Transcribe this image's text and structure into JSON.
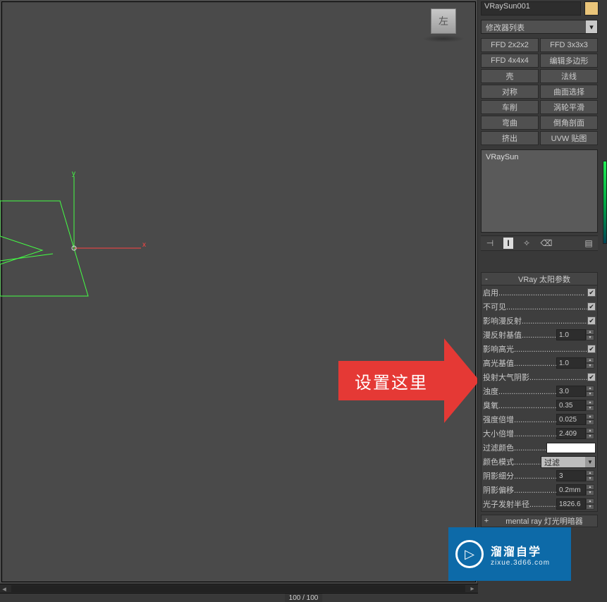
{
  "viewport": {
    "viewcube_label": "左",
    "axis_x": "x",
    "axis_y": "y"
  },
  "callout": {
    "text": "设置这里"
  },
  "object_name": "VRaySun001",
  "modifier_list_label": "修改器列表",
  "modifier_buttons": [
    "FFD 2x2x2",
    "FFD 3x3x3",
    "FFD 4x4x4",
    "编辑多边形",
    "壳",
    "法线",
    "对称",
    "曲面选择",
    "车削",
    "涡轮平滑",
    "弯曲",
    "倒角剖面",
    "挤出",
    "UVW 贴图"
  ],
  "stack": {
    "item": "VRaySun"
  },
  "rollout_title": "VRay 太阳参数",
  "params": [
    {
      "label": "启用",
      "type": "check",
      "value": true
    },
    {
      "label": "不可见",
      "type": "check",
      "value": true
    },
    {
      "label": "影响漫反射",
      "type": "check",
      "value": true
    },
    {
      "label": "漫反射基值",
      "type": "spinner",
      "value": "1.0"
    },
    {
      "label": "影响高光",
      "type": "check",
      "value": true
    },
    {
      "label": "高光基值",
      "type": "spinner",
      "value": "1.0"
    },
    {
      "label": "投射大气阴影",
      "type": "check",
      "value": true
    },
    {
      "label": "浊度",
      "type": "spinner",
      "value": "3.0"
    },
    {
      "label": "臭氧",
      "type": "spinner",
      "value": "0.35"
    },
    {
      "label": "强度倍增",
      "type": "spinner",
      "value": "0.025"
    },
    {
      "label": "大小倍增",
      "type": "spinner",
      "value": "2.409"
    },
    {
      "label": "过滤颜色",
      "type": "color"
    },
    {
      "label": "颜色模式",
      "type": "select",
      "value": "过滤"
    },
    {
      "label": "阴影细分",
      "type": "spinner",
      "value": "3"
    },
    {
      "label": "阴影偏移",
      "type": "spinner",
      "value": "0.2mm"
    },
    {
      "label": "光子发射半径",
      "type": "spinner",
      "value": "1826.6"
    }
  ],
  "rollout2_title": "mental ray 灯光明暗器",
  "timeline": {
    "frame": "100 / 100"
  },
  "watermark": {
    "line1": "溜溜自学",
    "line2": "zixue.3d66.com",
    "play": "▷"
  }
}
